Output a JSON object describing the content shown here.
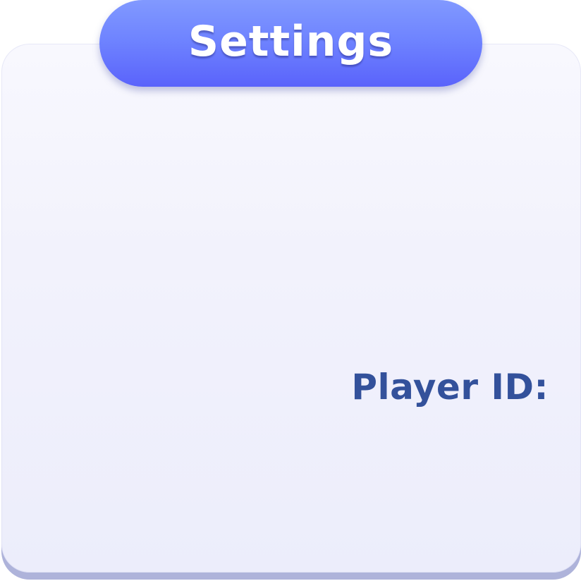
{
  "header": {
    "title": "Settings"
  },
  "panel": {
    "player_id_label": "Player ID:"
  },
  "colors": {
    "header_gradient_top": "#8199ff",
    "header_gradient_bottom": "#5a63fb",
    "panel_background": "#f2f2fc",
    "panel_shadow": "#aeb3da",
    "label_text": "#33519b",
    "header_text": "#ffffff"
  }
}
